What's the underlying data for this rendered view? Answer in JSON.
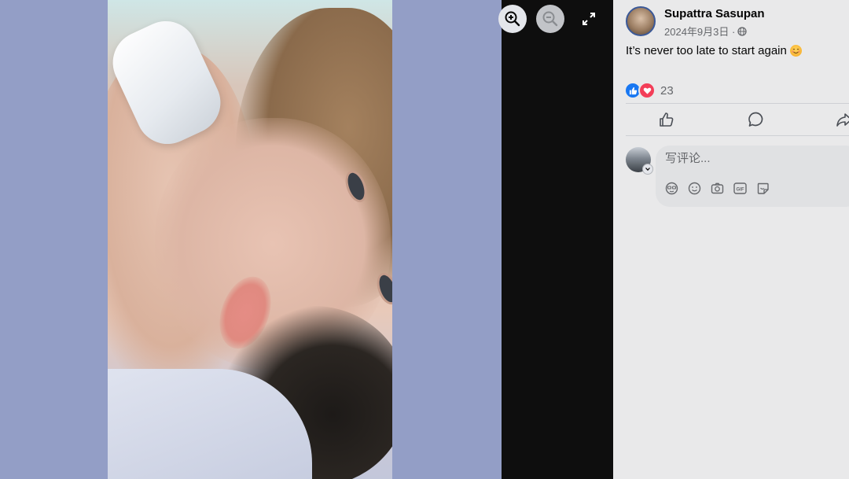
{
  "viewer": {
    "icons": {
      "zoom_in": "zoom-in-icon",
      "zoom_out": "zoom-out-icon",
      "expand": "expand-icon"
    }
  },
  "post": {
    "author": "Supattra Sasupan",
    "date": "2024年9月3日 ·",
    "privacy_icon": "globe-icon",
    "text": "It’s never too late to start again",
    "text_emoji": "smiling-face-emoji",
    "reaction_count": "23",
    "reaction_icons": [
      "like-reaction-icon",
      "love-reaction-icon"
    ]
  },
  "actions": {
    "icons": [
      "like-icon",
      "comment-icon",
      "share-icon"
    ]
  },
  "comment": {
    "placeholder": "写评论...",
    "tools": [
      "avatar-sticker-icon",
      "emoji-icon",
      "camera-icon",
      "gif-icon",
      "sticker-icon"
    ]
  },
  "colors": {
    "like_blue": "#1877f2",
    "love_red": "#f33e58",
    "photo_backdrop": "#939ec6",
    "viewer_black": "#0e0e0e",
    "panel_bg": "#e9e9ea"
  }
}
